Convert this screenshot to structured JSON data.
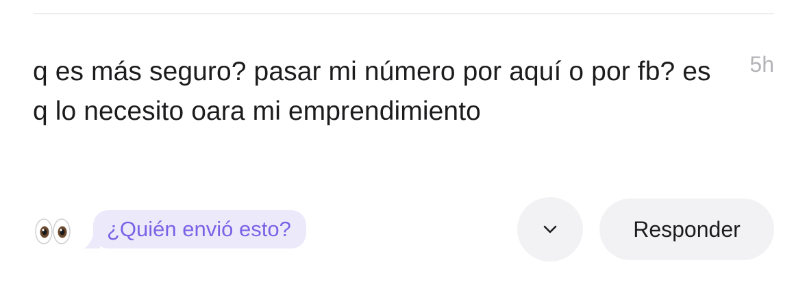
{
  "message": {
    "text": "q es más seguro? pasar mi número por aquí o por fb? es q lo necesito oara mi emprendimiento",
    "timestamp": "5h"
  },
  "reaction": {
    "emoji": "👀",
    "icon": "eyes-emoji-icon"
  },
  "who_sent": {
    "label": "¿Quién envió esto?"
  },
  "actions": {
    "more_icon": "chevron-down-icon",
    "reply_label": "Responder"
  },
  "colors": {
    "text": "#1c1c1e",
    "timestamp": "#b3b3b8",
    "accent": "#7b63e6",
    "accent_bg": "#ece9fb",
    "button_bg": "#f2f2f4",
    "divider": "#efeff1"
  }
}
